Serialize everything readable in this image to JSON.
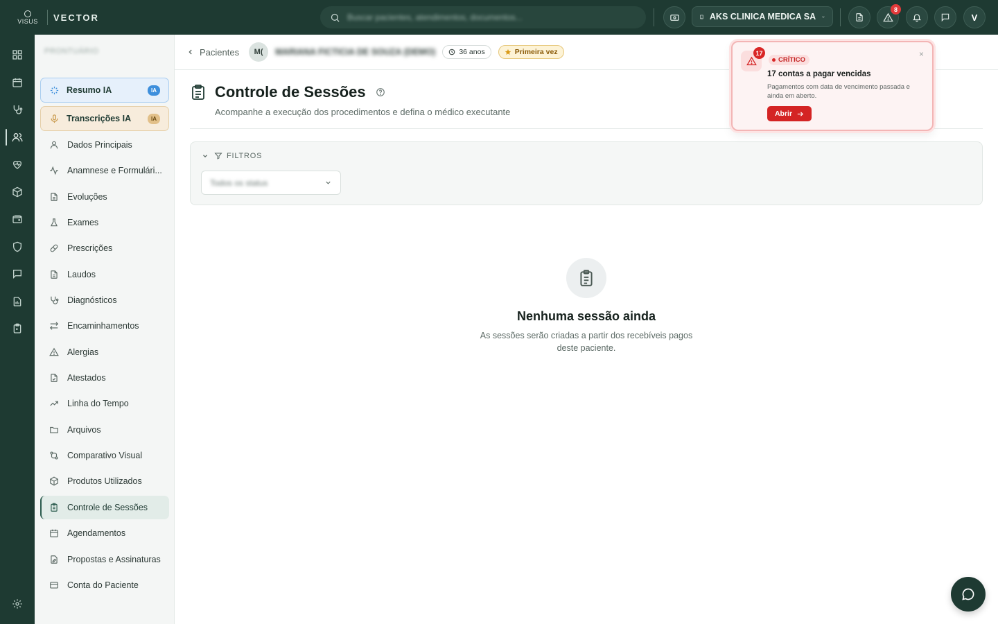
{
  "brand": {
    "logo_text": "VISUS",
    "name": "VECTOR"
  },
  "search": {
    "placeholder": "Buscar pacientes, atendimentos, documentos..."
  },
  "clinic": {
    "name": "AKS CLINICA MEDICA SA"
  },
  "topbar": {
    "alerts_badge": "8",
    "user_initial": "V"
  },
  "rail": {
    "items": [
      "dashboard-icon",
      "calendar-icon",
      "stethoscope-icon",
      "users-icon",
      "heart-pulse-icon",
      "box-icon",
      "wallet-icon",
      "shield-icon",
      "chat-icon",
      "report-icon",
      "clipboard-icon"
    ],
    "active_index": 3,
    "footer": "settings-icon"
  },
  "sidebar": {
    "title": "PRONTUÁRIO",
    "ai_items": [
      {
        "label": "Resumo IA",
        "tag": "IA"
      },
      {
        "label": "Transcrições IA",
        "tag": "IA"
      }
    ],
    "items": [
      {
        "label": "Dados Principais",
        "icon": "user-icon"
      },
      {
        "label": "Anamnese e Formulári...",
        "icon": "activity-icon"
      },
      {
        "label": "Evoluções",
        "icon": "document-icon"
      },
      {
        "label": "Exames",
        "icon": "flask-icon"
      },
      {
        "label": "Prescrições",
        "icon": "pill-icon"
      },
      {
        "label": "Laudos",
        "icon": "document-icon"
      },
      {
        "label": "Diagnósticos",
        "icon": "stethoscope-icon"
      },
      {
        "label": "Encaminhamentos",
        "icon": "arrows-icon"
      },
      {
        "label": "Alergias",
        "icon": "warning-icon"
      },
      {
        "label": "Atestados",
        "icon": "document-check-icon"
      },
      {
        "label": "Linha do Tempo",
        "icon": "trend-icon"
      },
      {
        "label": "Arquivos",
        "icon": "folder-icon"
      },
      {
        "label": "Comparativo Visual",
        "icon": "compare-icon"
      },
      {
        "label": "Produtos Utilizados",
        "icon": "box-icon"
      },
      {
        "label": "Controle de Sessões",
        "icon": "clipboard-icon",
        "active": true
      },
      {
        "label": "Agendamentos",
        "icon": "calendar-icon"
      },
      {
        "label": "Propostas e Assinaturas",
        "icon": "signature-icon"
      },
      {
        "label": "Conta do Paciente",
        "icon": "card-icon"
      }
    ]
  },
  "breadcrumb": {
    "back_label": "Pacientes",
    "patient_initials": "M(",
    "patient_name": "MARIANA FICTICIA DE SOUZA (DEMO)",
    "age_chip": "36 anos",
    "first_visit_chip": "Primeira vez"
  },
  "page": {
    "title": "Controle de Sessões",
    "subtitle": "Acompanhe a execução dos procedimentos e defina o médico executante"
  },
  "filters": {
    "label": "FILTROS",
    "status_value": "Todos os status"
  },
  "empty_state": {
    "title": "Nenhuma sessão ainda",
    "description": "As sessões serão criadas a partir dos recebíveis pagos deste paciente."
  },
  "alert": {
    "count": "17",
    "level": "CRÍTICO",
    "title": "17 contas a pagar vencidas",
    "description": "Pagamentos com data de vencimento passada e ainda em aberto.",
    "button": "Abrir",
    "close": "×"
  },
  "colors": {
    "brand_dark": "#1e3a32",
    "critical": "#d42424",
    "ia_blue": "#3e8fdc",
    "ia_amber": "#e2c089"
  }
}
